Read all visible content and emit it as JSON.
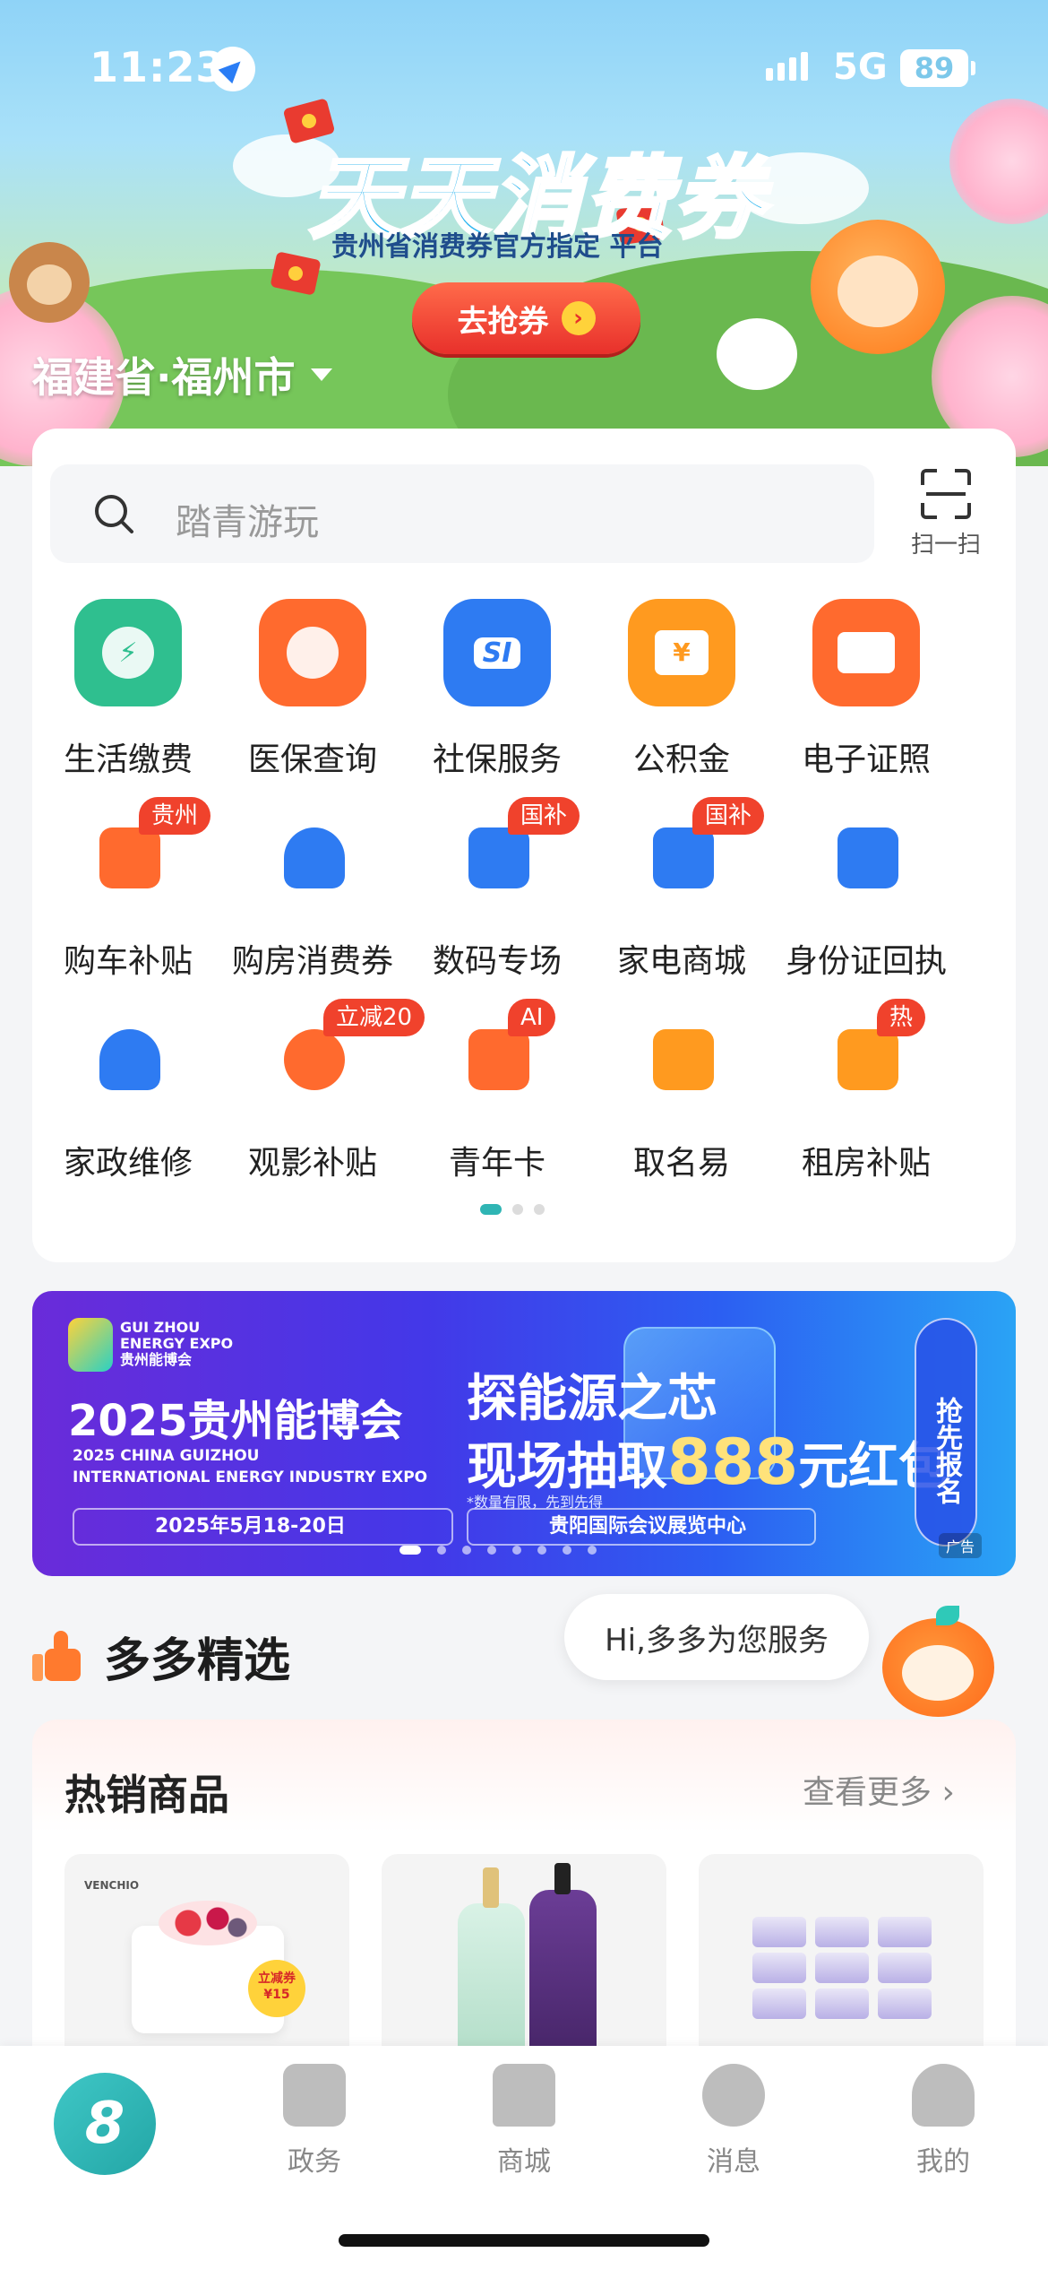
{
  "status": {
    "time": "11:23",
    "network": "5G",
    "battery": "89"
  },
  "hero": {
    "title": "天天消费券",
    "subtitle": "贵州省消费券官方指定 平台",
    "cta": "去抢券",
    "cta_arrow": "›",
    "city": "福建省·福州市"
  },
  "search": {
    "placeholder": "踏青游玩",
    "scan_label": "扫一扫"
  },
  "services": [
    [
      {
        "label": "生活缴费",
        "icon": "water-drop-icon",
        "color": "#2fbf8f",
        "glyph": "⚡"
      },
      {
        "label": "医保查询",
        "icon": "medical-insurance-icon",
        "color": "#ff6a2e",
        "glyph": ""
      },
      {
        "label": "社保服务",
        "icon": "social-security-icon",
        "color": "#2e7bf2",
        "glyph": "SI"
      },
      {
        "label": "公积金",
        "icon": "housing-fund-icon",
        "color": "#ff9a1f",
        "glyph": "¥"
      },
      {
        "label": "电子证照",
        "icon": "e-license-icon",
        "color": "#ff6a2e",
        "glyph": "▭"
      }
    ],
    [
      {
        "label": "购车补贴",
        "icon": "car-subsidy-icon",
        "color": "#ff6a2e",
        "badge": "贵州"
      },
      {
        "label": "购房消费券",
        "icon": "house-coupon-icon",
        "color": "#2e7bf2",
        "badge": ""
      },
      {
        "label": "数码专场",
        "icon": "digital-icon",
        "color": "#2e7bf2",
        "badge": "国补"
      },
      {
        "label": "家电商城",
        "icon": "appliance-icon",
        "color": "#2e7bf2",
        "badge": "国补"
      },
      {
        "label": "身份证回执",
        "icon": "id-receipt-icon",
        "color": "#2e7bf2",
        "badge": ""
      }
    ],
    [
      {
        "label": "家政维修",
        "icon": "home-repair-icon",
        "color": "#2e7bf2",
        "badge": ""
      },
      {
        "label": "观影补贴",
        "icon": "movie-icon",
        "color": "#ff6a2e",
        "badge": "立减20"
      },
      {
        "label": "青年卡",
        "icon": "youth-card-icon",
        "color": "#ff6a2e",
        "badge": "AI"
      },
      {
        "label": "取名易",
        "icon": "naming-icon",
        "color": "#ff9a1f",
        "badge": ""
      },
      {
        "label": "租房补贴",
        "icon": "rent-icon",
        "color": "#ff9a1f",
        "badge": "热"
      }
    ]
  ],
  "banner": {
    "logo_text": "GUI ZHOU\nENERGY EXPO\n贵州能博会",
    "title": "2025贵州能博会",
    "en_line1": "2025 CHINA GUIZHOU",
    "en_line2": "INTERNATIONAL ENERGY INDUSTRY EXPO",
    "headline1": "探能源之芯",
    "headline2_pre": "现场抽取",
    "headline2_num": "888",
    "headline2_post": "元红包",
    "note": "*数量有限，先到先得",
    "date": "2025年5月18-20日",
    "venue": "贵阳国际会议展览中心",
    "cta": "抢先报名",
    "ad": "广告"
  },
  "section": {
    "title": "多多精选",
    "assistant_greeting": "Hi,多多为您服务"
  },
  "products": {
    "title": "热销商品",
    "more": "查看更多 ›",
    "cake_brand": "VENCHIO",
    "cake_badge": "立减券\n¥15"
  },
  "tabbar": [
    {
      "label": "政务",
      "icon": "government-icon"
    },
    {
      "label": "商城",
      "icon": "mall-icon"
    },
    {
      "label": "消息",
      "icon": "message-icon"
    },
    {
      "label": "我的",
      "icon": "profile-icon"
    }
  ],
  "home_logo": "8"
}
